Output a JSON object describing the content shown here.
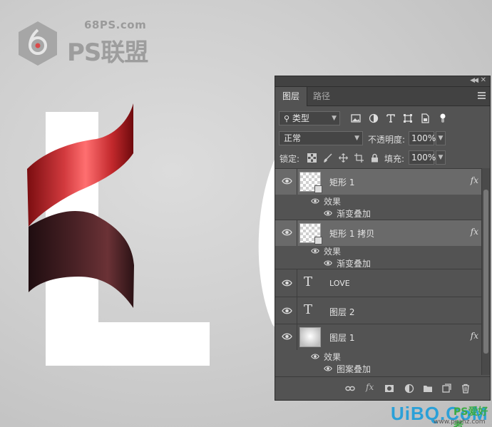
{
  "watermark": {
    "domain": "68PS.com",
    "brand": "PS联盟",
    "footer_brand": "UiBQ.CoM",
    "footer_tag": "PS爱好者",
    "footer_url": "www.psahz.com"
  },
  "colors": {
    "panel_bg": "#535353",
    "panel_dark": "#424242",
    "selected_row": "#6a6a6a",
    "ribbon_red": "#d33a3e",
    "ribbon_dark": "#3c1e22"
  },
  "panel": {
    "tabs": [
      {
        "label": "图层",
        "active": true
      },
      {
        "label": "路径",
        "active": false
      }
    ],
    "filter": {
      "label": "类型",
      "icons": [
        "image-filter-icon",
        "adjustment-filter-icon",
        "type-filter-icon",
        "shape-filter-icon",
        "smart-object-filter-icon",
        "filter-toggle-icon"
      ]
    },
    "blend_mode": "正常",
    "opacity_label": "不透明度:",
    "opacity_value": "100%",
    "lock_label": "锁定:",
    "fill_label": "填充:",
    "fill_value": "100%",
    "layers": [
      {
        "name": "矩形 1",
        "kind": "shape",
        "selected": true,
        "fx": "fx",
        "effects_label": "效果",
        "effect": "渐变叠加"
      },
      {
        "name": "矩形 1 拷贝",
        "kind": "shape",
        "selected": true,
        "fx": "fx",
        "effects_label": "效果",
        "effect": "渐变叠加"
      },
      {
        "name": "LOVE",
        "kind": "text",
        "glyph": "T"
      },
      {
        "name": "图层 2",
        "kind": "text",
        "glyph": "T"
      },
      {
        "name": "图层 1",
        "kind": "pixel",
        "fx": "fx",
        "effects_label": "效果",
        "effect": "图案叠加"
      }
    ],
    "bottom_icons": [
      "link-layers-icon",
      "fx-icon",
      "mask-icon",
      "adjustment-icon",
      "group-folder-icon",
      "new-layer-icon",
      "trash-icon"
    ],
    "fx_bottom": "fx"
  }
}
